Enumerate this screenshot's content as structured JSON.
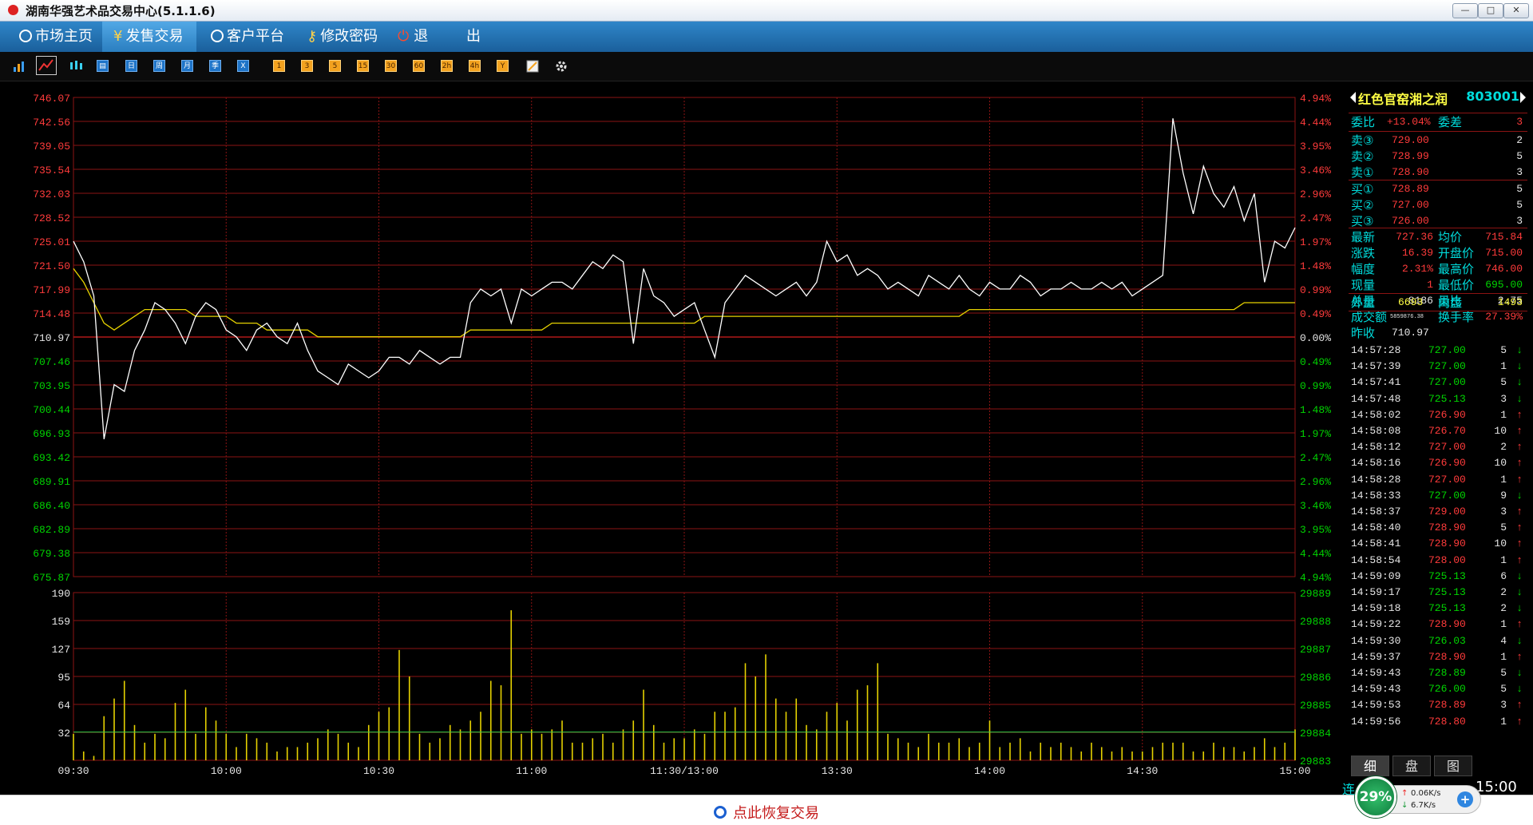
{
  "window": {
    "title": "湖南华强艺术品交易中心(5.1.1.6)",
    "btn_min": "—",
    "btn_max": "□",
    "btn_close": "✕"
  },
  "menu": {
    "items": [
      {
        "label": "市场主页",
        "icon": "refresh-icon"
      },
      {
        "label": "发售交易",
        "icon": "yen-icon"
      },
      {
        "label": "客户平台",
        "icon": "refresh-icon"
      },
      {
        "label": "修改密码",
        "icon": "key-icon"
      },
      {
        "label": "退",
        "icon": "power-icon"
      },
      {
        "label": "出"
      }
    ]
  },
  "toolbar": {
    "period_buttons": [
      "日",
      "周",
      "月",
      "季",
      "X"
    ],
    "minute_buttons": [
      "1",
      "3",
      "5",
      "15",
      "30",
      "60",
      "2h",
      "4h",
      "Y"
    ]
  },
  "stock": {
    "name": "红色官窑湘之润",
    "code": "803001"
  },
  "quote": {
    "weibi_label": "委比",
    "weibi": "+13.04%",
    "weicha_label": "委差",
    "weicha": "3",
    "sell": [
      {
        "label": "卖③",
        "price": "729.00",
        "vol": "2"
      },
      {
        "label": "卖②",
        "price": "728.99",
        "vol": "5"
      },
      {
        "label": "卖①",
        "price": "728.90",
        "vol": "3"
      }
    ],
    "buy": [
      {
        "label": "买①",
        "price": "728.89",
        "vol": "5"
      },
      {
        "label": "买②",
        "price": "727.00",
        "vol": "5"
      },
      {
        "label": "买③",
        "price": "726.00",
        "vol": "3"
      }
    ],
    "latest_label": "最新",
    "latest": "727.36",
    "avg_label": "均价",
    "avg": "715.84",
    "change_label": "涨跌",
    "change": "16.39",
    "open_label": "开盘价",
    "open": "715.00",
    "amp_label": "幅度",
    "amp": "2.31%",
    "high_label": "最高价",
    "high": "746.00",
    "curvol_label": "现量",
    "curvol": "1",
    "low_label": "最低价",
    "low": "695.00",
    "total_label": "总量",
    "total": "8186",
    "volratio_label": "量比",
    "volratio": "2.75",
    "turnover_label": "成交额",
    "turnover": "5859876.38",
    "turnrate_label": "换手率",
    "turnrate": "27.39%",
    "prevclose_label": "昨收",
    "prevclose": "710.97",
    "outer_label": "外盘",
    "outer": "6693",
    "inner_label": "内盘",
    "inner": "1493"
  },
  "ticks": [
    {
      "t": "14:57:28",
      "p": "727.00",
      "v": "5",
      "d": "↓"
    },
    {
      "t": "14:57:39",
      "p": "727.00",
      "v": "1",
      "d": "↓"
    },
    {
      "t": "14:57:41",
      "p": "727.00",
      "v": "5",
      "d": "↓"
    },
    {
      "t": "14:57:48",
      "p": "725.13",
      "v": "3",
      "d": "↓"
    },
    {
      "t": "14:58:02",
      "p": "726.90",
      "v": "1",
      "d": "↑"
    },
    {
      "t": "14:58:08",
      "p": "726.70",
      "v": "10",
      "d": "↑"
    },
    {
      "t": "14:58:12",
      "p": "727.00",
      "v": "2",
      "d": "↑"
    },
    {
      "t": "14:58:16",
      "p": "726.90",
      "v": "10",
      "d": "↑"
    },
    {
      "t": "14:58:28",
      "p": "727.00",
      "v": "1",
      "d": "↑"
    },
    {
      "t": "14:58:33",
      "p": "727.00",
      "v": "9",
      "d": "↓"
    },
    {
      "t": "14:58:37",
      "p": "729.00",
      "v": "3",
      "d": "↑"
    },
    {
      "t": "14:58:40",
      "p": "728.90",
      "v": "5",
      "d": "↑"
    },
    {
      "t": "14:58:41",
      "p": "728.90",
      "v": "10",
      "d": "↑"
    },
    {
      "t": "14:58:54",
      "p": "728.00",
      "v": "1",
      "d": "↑"
    },
    {
      "t": "14:59:09",
      "p": "725.13",
      "v": "6",
      "d": "↓"
    },
    {
      "t": "14:59:17",
      "p": "725.13",
      "v": "2",
      "d": "↓"
    },
    {
      "t": "14:59:18",
      "p": "725.13",
      "v": "2",
      "d": "↓"
    },
    {
      "t": "14:59:22",
      "p": "728.90",
      "v": "1",
      "d": "↑"
    },
    {
      "t": "14:59:30",
      "p": "726.03",
      "v": "4",
      "d": "↓"
    },
    {
      "t": "14:59:37",
      "p": "728.90",
      "v": "1",
      "d": "↑"
    },
    {
      "t": "14:59:43",
      "p": "728.89",
      "v": "5",
      "d": "↓"
    },
    {
      "t": "14:59:43",
      "p": "726.00",
      "v": "5",
      "d": "↓"
    },
    {
      "t": "14:59:53",
      "p": "728.89",
      "v": "3",
      "d": "↑"
    },
    {
      "t": "14:59:56",
      "p": "728.80",
      "v": "1",
      "d": "↑"
    }
  ],
  "tabs": [
    "细",
    "盘",
    "图"
  ],
  "status": {
    "restore": "点此恢复交易",
    "connection": "连",
    "clock": "15:00",
    "net_percent": "29%",
    "up_speed": "0.06K/s",
    "down_speed": "6.7K/s",
    "plus": "+"
  },
  "colors": {
    "up": "#ff3b3b",
    "down": "#00d400",
    "accent": "#00dcdc",
    "highlight": "#ffff44",
    "grid": "#8b1313"
  },
  "chart_data": {
    "type": "line",
    "price_ticks": [
      "746.07",
      "742.56",
      "739.05",
      "735.54",
      "732.03",
      "728.52",
      "725.01",
      "721.50",
      "717.99",
      "714.48",
      "710.97",
      "707.46",
      "703.95",
      "700.44",
      "696.93",
      "693.42",
      "689.91",
      "686.40",
      "682.89",
      "679.38",
      "675.87"
    ],
    "pct_ticks": [
      "4.94%",
      "4.44%",
      "3.95%",
      "3.46%",
      "2.96%",
      "2.47%",
      "1.97%",
      "1.48%",
      "0.99%",
      "0.49%",
      "0.00%",
      "0.49%",
      "0.99%",
      "1.48%",
      "1.97%",
      "2.47%",
      "2.96%",
      "3.46%",
      "3.95%",
      "4.44%",
      "4.94%"
    ],
    "vol_ticks": [
      "190",
      "159",
      "127",
      "95",
      "64",
      "32"
    ],
    "vol_right_ticks": [
      "29889",
      "29888",
      "29887",
      "29886",
      "29885",
      "29884",
      "29883"
    ],
    "time_ticks": [
      "09:30",
      "10:00",
      "10:30",
      "11:00",
      "11:30/13:00",
      "13:30",
      "14:00",
      "14:30",
      "15:00"
    ],
    "ylim": [
      675.87,
      746.07
    ],
    "prev_close": 710.97,
    "price_series": [
      725,
      722,
      717,
      696,
      704,
      703,
      709,
      712,
      716,
      715,
      713,
      710,
      714,
      716,
      715,
      712,
      711,
      709,
      712,
      713,
      711,
      710,
      713,
      709,
      706,
      705,
      704,
      707,
      706,
      705,
      706,
      708,
      708,
      707,
      709,
      708,
      707,
      708,
      708,
      716,
      718,
      717,
      718,
      713,
      718,
      717,
      718,
      719,
      719,
      718,
      720,
      722,
      721,
      723,
      722,
      710,
      721,
      717,
      716,
      714,
      715,
      716,
      712,
      708,
      716,
      718,
      720,
      719,
      718,
      717,
      718,
      719,
      717,
      719,
      725,
      722,
      723,
      720,
      721,
      720,
      718,
      719,
      718,
      717,
      720,
      719,
      718,
      720,
      718,
      717,
      719,
      718,
      718,
      720,
      719,
      717,
      718,
      718,
      719,
      718,
      718,
      719,
      718,
      719,
      717,
      718,
      719,
      720,
      743,
      735,
      729,
      736,
      732,
      730,
      733,
      728,
      732,
      719,
      725,
      724,
      727
    ],
    "avg_series": [
      721,
      719,
      716,
      713,
      712,
      713,
      714,
      715,
      715,
      715,
      715,
      715,
      714,
      714,
      714,
      714,
      713,
      713,
      713,
      712,
      712,
      712,
      712,
      712,
      711,
      711,
      711,
      711,
      711,
      711,
      711,
      711,
      711,
      711,
      711,
      711,
      711,
      711,
      711,
      712,
      712,
      712,
      712,
      712,
      712,
      712,
      712,
      713,
      713,
      713,
      713,
      713,
      713,
      713,
      713,
      713,
      713,
      713,
      713,
      713,
      713,
      713,
      714,
      714,
      714,
      714,
      714,
      714,
      714,
      714,
      714,
      714,
      714,
      714,
      714,
      714,
      714,
      714,
      714,
      714,
      714,
      714,
      714,
      714,
      714,
      714,
      714,
      714,
      715,
      715,
      715,
      715,
      715,
      715,
      715,
      715,
      715,
      715,
      715,
      715,
      715,
      715,
      715,
      715,
      715,
      715,
      715,
      715,
      715,
      715,
      715,
      715,
      715,
      715,
      715,
      716,
      716,
      716,
      716,
      716,
      716
    ],
    "volume_series": [
      30,
      10,
      5,
      50,
      70,
      90,
      40,
      20,
      30,
      25,
      65,
      80,
      30,
      60,
      45,
      30,
      15,
      30,
      25,
      20,
      10,
      15,
      15,
      20,
      25,
      35,
      30,
      20,
      15,
      40,
      55,
      60,
      125,
      95,
      30,
      20,
      25,
      40,
      35,
      45,
      55,
      90,
      85,
      170,
      30,
      35,
      30,
      35,
      45,
      20,
      20,
      25,
      30,
      20,
      35,
      45,
      80,
      40,
      20,
      25,
      25,
      35,
      30,
      55,
      55,
      60,
      110,
      95,
      120,
      70,
      55,
      70,
      40,
      35,
      55,
      65,
      45,
      80,
      85,
      110,
      30,
      25,
      20,
      15,
      30,
      20,
      20,
      25,
      15,
      20,
      45,
      15,
      20,
      25,
      10,
      20,
      15,
      20,
      15,
      10,
      20,
      15,
      10,
      15,
      10,
      10,
      15,
      20,
      20,
      20,
      10,
      10,
      20,
      15,
      15,
      10,
      15,
      25,
      15,
      20,
      35
    ]
  }
}
